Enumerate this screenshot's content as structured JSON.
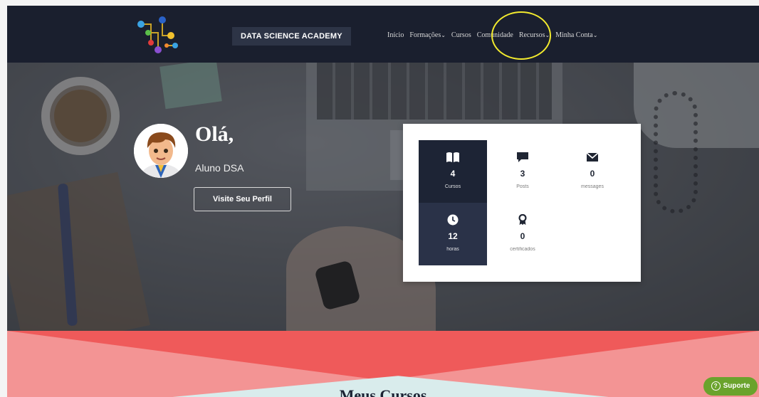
{
  "nav": {
    "brand": "DATA SCIENCE ACADEMY",
    "items": [
      {
        "label": "Início",
        "caret": false
      },
      {
        "label": "Formações",
        "caret": true
      },
      {
        "label": "Cursos",
        "caret": false
      },
      {
        "label": "Comunidade",
        "caret": false
      },
      {
        "label": "Recursos",
        "caret": true
      },
      {
        "label": "Minha Conta",
        "caret": true
      }
    ],
    "highlight_color": "#f2ea2e"
  },
  "profile": {
    "greeting": "Olá,",
    "username": "Aluno DSA",
    "button_label": "Visite Seu Perfil"
  },
  "stats": [
    {
      "icon": "book-icon",
      "value": "4",
      "label": "Cursos"
    },
    {
      "icon": "comment-icon",
      "value": "3",
      "label": "Posts"
    },
    {
      "icon": "envelope-icon",
      "value": "0",
      "label": "messages"
    },
    {
      "icon": "clock-icon",
      "value": "12",
      "label": "horas"
    },
    {
      "icon": "award-icon",
      "value": "0",
      "label": "certificados"
    }
  ],
  "section": {
    "title": "Meus Cursos"
  },
  "support": {
    "label": "Suporte"
  },
  "colors": {
    "navbar": "#1a1f2e",
    "stat_dark": "#1d2435",
    "accent_red": "#ef5a5a",
    "support_green": "#6aa32c"
  }
}
